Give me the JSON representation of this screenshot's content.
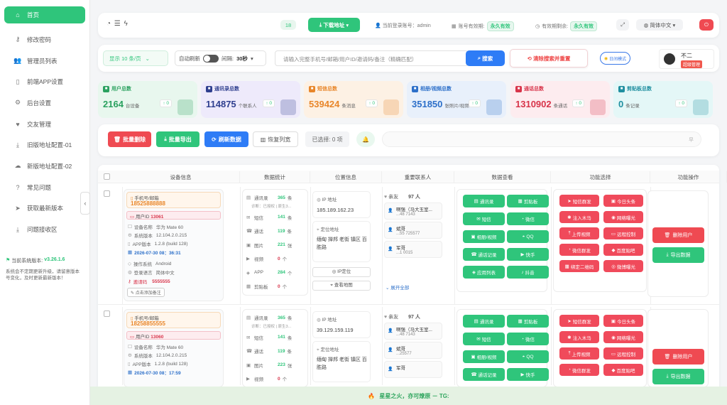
{
  "sidebar": {
    "items": [
      {
        "icon": "home-icon",
        "glyph": "⌂",
        "label": "首页"
      },
      {
        "icon": "key-icon",
        "glyph": "⚷",
        "label": "修改密码"
      },
      {
        "icon": "users-icon",
        "glyph": "👥",
        "label": "管理员列表"
      },
      {
        "icon": "mobile-icon",
        "glyph": "▯",
        "label": "前端APP设置"
      },
      {
        "icon": "settings-icon",
        "glyph": "⚙",
        "label": "后台设置"
      },
      {
        "icon": "heart-icon",
        "glyph": "♥",
        "label": "交友管理"
      },
      {
        "icon": "download-icon",
        "glyph": "⤓",
        "label": "旧版地址配置-01"
      },
      {
        "icon": "cloud-download-icon",
        "glyph": "☁",
        "label": "新版地址配置-02"
      },
      {
        "icon": "question-icon",
        "glyph": "?",
        "label": "常见问题"
      },
      {
        "icon": "send-icon",
        "glyph": "➤",
        "label": "获取最新版本"
      },
      {
        "icon": "inbox-icon",
        "glyph": "⤓",
        "label": "问题接收区"
      }
    ],
    "version_label": "当前系统版本:",
    "version_value": "v3.26.1.6",
    "note": "系统会不定期更新升级，请留意版本号变化，及时更新最新版本！"
  },
  "topbar": {
    "count_badge": "18",
    "download_label": "下载地址",
    "current_user_label": "当前登录账号：",
    "current_user": "admin",
    "validity_label": "账号有效期:",
    "validity_value": "永久有效",
    "remaining_label": "有效期剩余:",
    "remaining_value": "永久有效",
    "language": "简体中文"
  },
  "filterbar": {
    "page_size": "显示 10 条/页",
    "auto_refresh_label": "自动刷新",
    "interval_label": "间隔:",
    "interval_value": "30秒",
    "search_placeholder": "请输入完整手机号/邮箱/用户ID/邀请码/备注（精确匹配）",
    "search_button": "搜索",
    "clear_button": "清除搜索并重置",
    "theme_label": "日间模式",
    "username": "不二",
    "role": "超级管理"
  },
  "stats": [
    {
      "label": "用户总数",
      "value": "2164",
      "unit": "台设备",
      "delta": "0",
      "color": "#2aa15f",
      "bg": "#e8f7ee"
    },
    {
      "label": "通讯录总数",
      "value": "114875",
      "unit": "个联系人",
      "delta": "0",
      "color": "#2f3f8f",
      "bg": "#eeeafb"
    },
    {
      "label": "短信总数",
      "value": "539424",
      "unit": "条消息",
      "delta": "0",
      "color": "#e8862a",
      "bg": "#fdf1e4"
    },
    {
      "label": "相册/视频总数",
      "value": "351850",
      "unit": "张照片/视频",
      "delta": "0",
      "color": "#2c6fc9",
      "bg": "#e8f0fb"
    },
    {
      "label": "通话总数",
      "value": "1310902",
      "unit": "条通话",
      "delta": "0",
      "color": "#d8344a",
      "bg": "#fdecef"
    },
    {
      "label": "剪贴板总数",
      "value": "0",
      "unit": "条记录",
      "delta": "0",
      "color": "#1f8fa0",
      "bg": "#e4f7f7"
    }
  ],
  "actions": {
    "batch_delete": "批量删除",
    "batch_export": "批量导出",
    "refresh": "刷新数据",
    "restore_width": "恢复列宽",
    "selected": "已选择: 0 项",
    "marquee": "早"
  },
  "table_headers": [
    "设备信息",
    "数据统计",
    "位置信息",
    "重要联系人",
    "数据查看",
    "功能选择",
    "功能操作"
  ],
  "rows": [
    {
      "contact_label": "手机号/邮箱",
      "contact": "18525888888",
      "user_id_label": "用户ID",
      "user_id": "13061",
      "device_model_label": "设备名称",
      "device_model": "华为 Mate 60",
      "sys_version_label": "系统版本",
      "sys_version": "12.104.2.0.215",
      "app_version_label": "APP版本",
      "app_version": "1.2.8 (build 128)",
      "datetime": "2026-07-30 08：36:31",
      "os_label": "操作系统",
      "os": "Android",
      "lang_label": "登录语言",
      "lang": "简体中文",
      "invite_label": "邀请码",
      "invite": "5555555",
      "note_button": "点击添加备注",
      "stats": [
        {
          "icon": "contacts-icon",
          "glyph": "▤",
          "label": "通讯录",
          "value": "365",
          "unit": "条"
        },
        {
          "icon": "sms-icon",
          "glyph": "✉",
          "label": "短信",
          "value": "141",
          "unit": "条"
        },
        {
          "icon": "call-icon",
          "glyph": "☎",
          "label": "通话",
          "value": "119",
          "unit": "条"
        },
        {
          "icon": "image-icon",
          "glyph": "▣",
          "label": "图片",
          "value": "221",
          "unit": "张"
        },
        {
          "icon": "video-icon",
          "glyph": "▶",
          "label": "视频",
          "value": "0",
          "unit": "个"
        },
        {
          "icon": "app-icon",
          "glyph": "◈",
          "label": "APP",
          "value": "284",
          "unit": "个"
        },
        {
          "icon": "clipboard-icon",
          "glyph": "▦",
          "label": "剪贴板",
          "value": "0",
          "unit": "个"
        }
      ],
      "sub_note": "诊断：已授权 | 原生3...",
      "ip_label": "IP 地址",
      "ip": "185.189.162.23",
      "loc_label": "定位地址",
      "loc": "缅甸 掸邦 老街 镇区 百胜路",
      "ip_locate": "IP定位",
      "view_map": "查看地图",
      "friend_label": "亲友",
      "friend_count": "97 人",
      "contacts": [
        {
          "name": "啊强（马大玉室...",
          "phone": "...48 7143"
        },
        {
          "name": "斌哥",
          "phone": "...55 725577"
        },
        {
          "name": "军哥",
          "phone": "...1 0015"
        }
      ],
      "expand": "展开全部"
    },
    {
      "contact_label": "手机号/邮箱",
      "contact": "18258855555",
      "user_id_label": "用户ID",
      "user_id": "13060",
      "device_model_label": "设备名称",
      "device_model": "华为 Mate 60",
      "sys_version_label": "系统版本",
      "sys_version": "12.104.2.0.215",
      "app_version_label": "APP版本",
      "app_version": "1.2.8 (build 128)",
      "datetime": "2026-07-30 08：17:59",
      "stats": [
        {
          "icon": "contacts-icon",
          "glyph": "▤",
          "label": "通讯录",
          "value": "365",
          "unit": "条"
        },
        {
          "icon": "sms-icon",
          "glyph": "✉",
          "label": "短信",
          "value": "141",
          "unit": "条"
        },
        {
          "icon": "call-icon",
          "glyph": "☎",
          "label": "通话",
          "value": "119",
          "unit": "条"
        },
        {
          "icon": "image-icon",
          "glyph": "▣",
          "label": "图片",
          "value": "223",
          "unit": "张"
        },
        {
          "icon": "video-icon",
          "glyph": "▶",
          "label": "视频",
          "value": "0",
          "unit": "个"
        }
      ],
      "sub_note": "诊断：已授权 | 原生3...",
      "ip_label": "IP 地址",
      "ip": "39.129.159.119",
      "loc_label": "定位地址",
      "loc": "缅甸 掸邦 老街 镇区 百胜路",
      "friend_label": "亲友",
      "friend_count": "97 人",
      "contacts": [
        {
          "name": "啊强（马大玉室...",
          "phone": "...48 7143"
        },
        {
          "name": "斌哥",
          "phone": "...25577"
        },
        {
          "name": "军哥",
          "phone": ""
        }
      ]
    }
  ],
  "data_view_buttons": [
    "通讯录",
    "剪贴板",
    "短信",
    "微信",
    "相册/视频",
    "QQ",
    "通话记录",
    "快手",
    "应用列表",
    "抖音"
  ],
  "feature_buttons": [
    "短信群发",
    "今日头条",
    "注入木马",
    "网络曝光",
    "上传视频",
    "远程控制",
    "微信群发",
    "百度贴吧",
    "绑定二维码",
    "微博曝光"
  ],
  "op_buttons": {
    "delete": "删除用户",
    "export": "导出数据"
  },
  "footer": {
    "text": "星星之火，亦可燎原 － TG:"
  }
}
